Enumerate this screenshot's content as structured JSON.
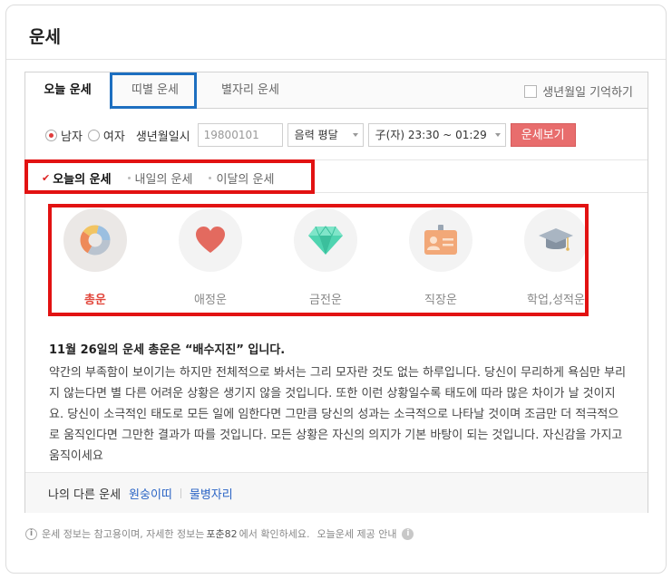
{
  "title": "운세",
  "tabs": [
    {
      "label": "오늘 운세"
    },
    {
      "label": "띠별 운세"
    },
    {
      "label": "별자리 운세"
    }
  ],
  "remember_label": "생년월일 기억하기",
  "form": {
    "gender_male": "남자",
    "gender_female": "여자",
    "birth_label": "생년월일시",
    "birth_placeholder": "19800101",
    "calendar_value": "음력 평달",
    "time_value": "子(자) 23:30 ~ 01:29",
    "submit_label": "운세보기"
  },
  "subtabs": [
    {
      "label": "오늘의 운세"
    },
    {
      "label": "내일의 운세"
    },
    {
      "label": "이달의 운세"
    }
  ],
  "categories": [
    {
      "label": "총운",
      "icon": "donut-chart-icon"
    },
    {
      "label": "애정운",
      "icon": "heart-icon"
    },
    {
      "label": "금전운",
      "icon": "gem-icon"
    },
    {
      "label": "직장운",
      "icon": "id-card-icon"
    },
    {
      "label": "학업,성적운",
      "icon": "graduation-cap-icon"
    }
  ],
  "fortune": {
    "title": "11월 26일의 운세 총운은 “배수지진” 입니다.",
    "body": "약간의 부족함이 보이기는 하지만 전체적으로 봐서는 그리 모자란 것도 없는 하루입니다. 당신이 무리하게 욕심만 부리지 않는다면 별 다른 어려운 상황은 생기지 않을 것입니다. 또한 이런 상황일수록 태도에 따라 많은 차이가 날 것이지요. 당신이 소극적인 태도로 모든 일에 임한다면 그만큼 당신의 성과는 소극적으로 나타날 것이며 조금만 더 적극적으로 움직인다면 그만한 결과가 따를 것입니다. 모든 상황은 자신의 의지가 기본 바탕이 되는 것입니다. 자신감을 가지고 움직이세요"
  },
  "footer": {
    "label": "나의 다른 운세",
    "link1": "원숭이띠",
    "link2": "물병자리"
  },
  "notice": {
    "text1": "운세 정보는 참고용이며, 자세한 정보는",
    "brand": "포춘82",
    "text2": "에서 확인하세요.",
    "provider": "오늘운세 제공 안내"
  },
  "colors": {
    "accent_red": "#e2473c",
    "button_red": "#e86d6d",
    "link_blue": "#2a64c5",
    "highlight_red": "#e21212",
    "highlight_blue": "#1d6fc0"
  }
}
